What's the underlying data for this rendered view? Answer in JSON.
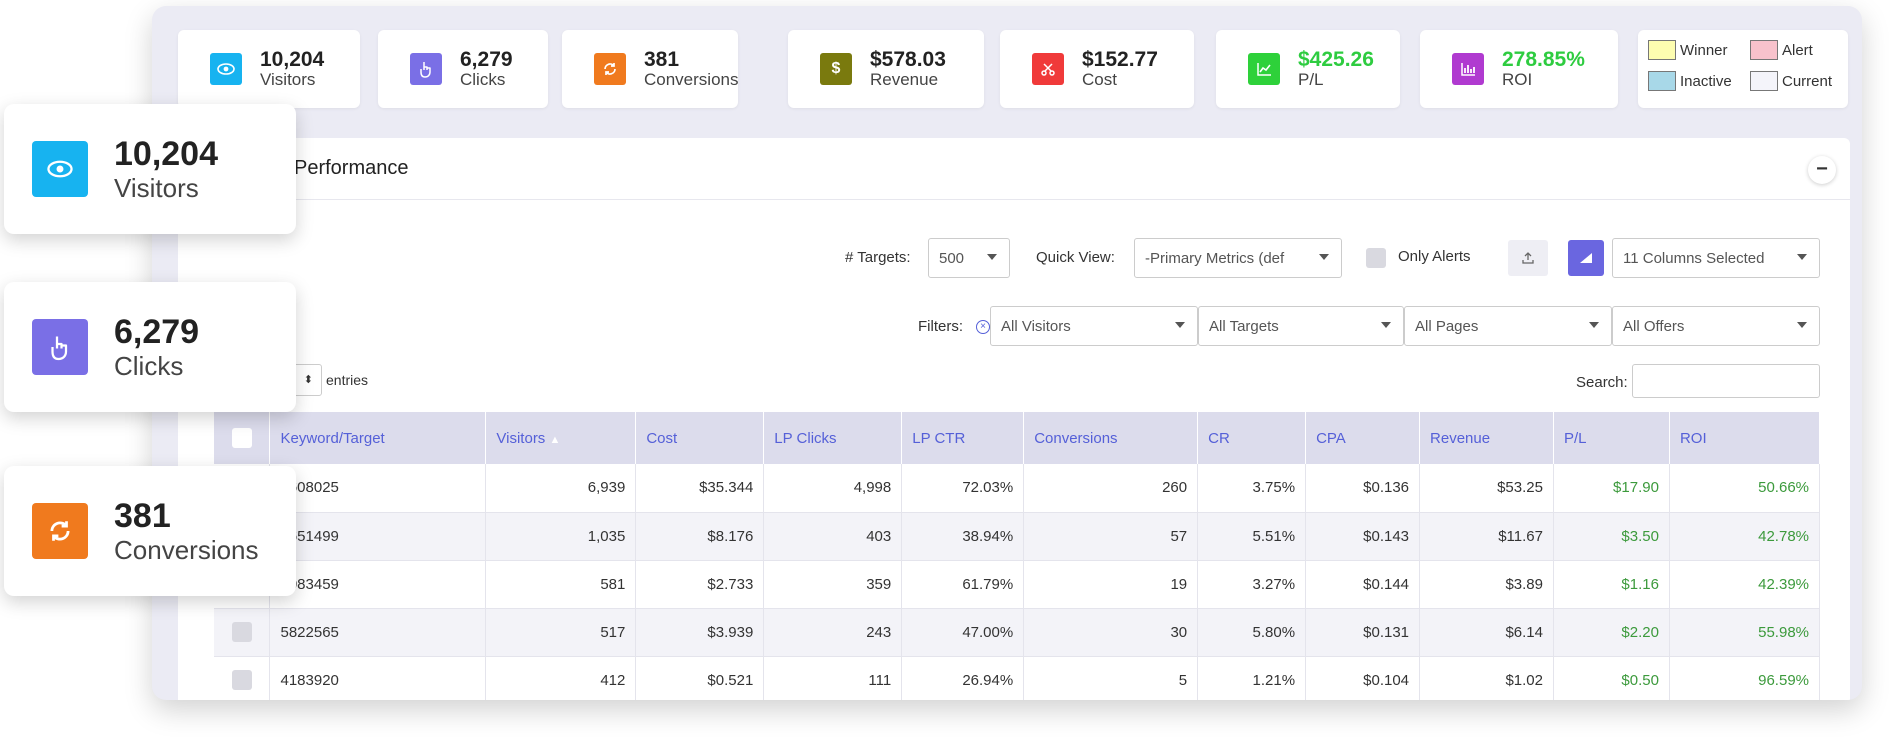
{
  "stats": [
    {
      "value": "10,204",
      "label": "Visitors",
      "icon": "eye-icon",
      "color": "#17b3f0"
    },
    {
      "value": "6,279",
      "label": "Clicks",
      "icon": "pointer-hand-icon",
      "color": "#7a6fe6"
    },
    {
      "value": "381",
      "label": "Conversions",
      "icon": "refresh-icon",
      "color": "#f07a1e"
    },
    {
      "value": "$578.03",
      "label": "Revenue",
      "icon": "dollar-icon",
      "color": "#7a7a0e"
    },
    {
      "value": "$152.77",
      "label": "Cost",
      "icon": "scissors-icon",
      "color": "#f03a3a"
    },
    {
      "value": "$425.26",
      "label": "P/L",
      "icon": "trend-up-icon",
      "color": "#2ed13a"
    },
    {
      "value": "278.85%",
      "label": "ROI",
      "icon": "bar-chart-icon",
      "color": "#b03ad0"
    }
  ],
  "legend": {
    "winner": "Winner",
    "alert": "Alert",
    "inactive": "Inactive",
    "current": "Current",
    "winner_color": "#fdfdb0",
    "alert_color": "#f8c2cc",
    "inactive_color": "#a8d8e8",
    "current_color": "#f4f4fa"
  },
  "panel": {
    "title": "Performance",
    "collapse": "−",
    "targets_label": "# Targets:",
    "targets_value": "500",
    "quickview_label": "Quick View:",
    "quickview_value": "-Primary Metrics (def",
    "only_alerts": "Only Alerts",
    "columns_selected": "11 Columns Selected",
    "filters_label": "Filters:",
    "filter_visitors": "All Visitors",
    "filter_targets": "All Targets",
    "filter_pages": "All Pages",
    "filter_offers": "All Offers",
    "entries_label": "entries",
    "search_label": "Search:"
  },
  "table": {
    "headers": [
      "Keyword/Target",
      "Visitors",
      "Cost",
      "LP Clicks",
      "LP CTR",
      "Conversions",
      "CR",
      "CPA",
      "Revenue",
      "P/L",
      "ROI"
    ],
    "rows": [
      [
        "5608025",
        "6,939",
        "$35.344",
        "4,998",
        "72.03%",
        "260",
        "3.75%",
        "$0.136",
        "$53.25",
        "$17.90",
        "50.66%"
      ],
      [
        "5651499",
        "1,035",
        "$8.176",
        "403",
        "38.94%",
        "57",
        "5.51%",
        "$0.143",
        "$11.67",
        "$3.50",
        "42.78%"
      ],
      [
        "6083459",
        "581",
        "$2.733",
        "359",
        "61.79%",
        "19",
        "3.27%",
        "$0.144",
        "$3.89",
        "$1.16",
        "42.39%"
      ],
      [
        "5822565",
        "517",
        "$3.939",
        "243",
        "47.00%",
        "30",
        "5.80%",
        "$0.131",
        "$6.14",
        "$2.20",
        "55.98%"
      ],
      [
        "4183920",
        "412",
        "$0.521",
        "111",
        "26.94%",
        "5",
        "1.21%",
        "$0.104",
        "$1.02",
        "$0.50",
        "96.59%"
      ]
    ]
  },
  "floats": [
    {
      "value": "10,204",
      "label": "Visitors"
    },
    {
      "value": "6,279",
      "label": "Clicks"
    },
    {
      "value": "381",
      "label": "Conversions"
    }
  ]
}
